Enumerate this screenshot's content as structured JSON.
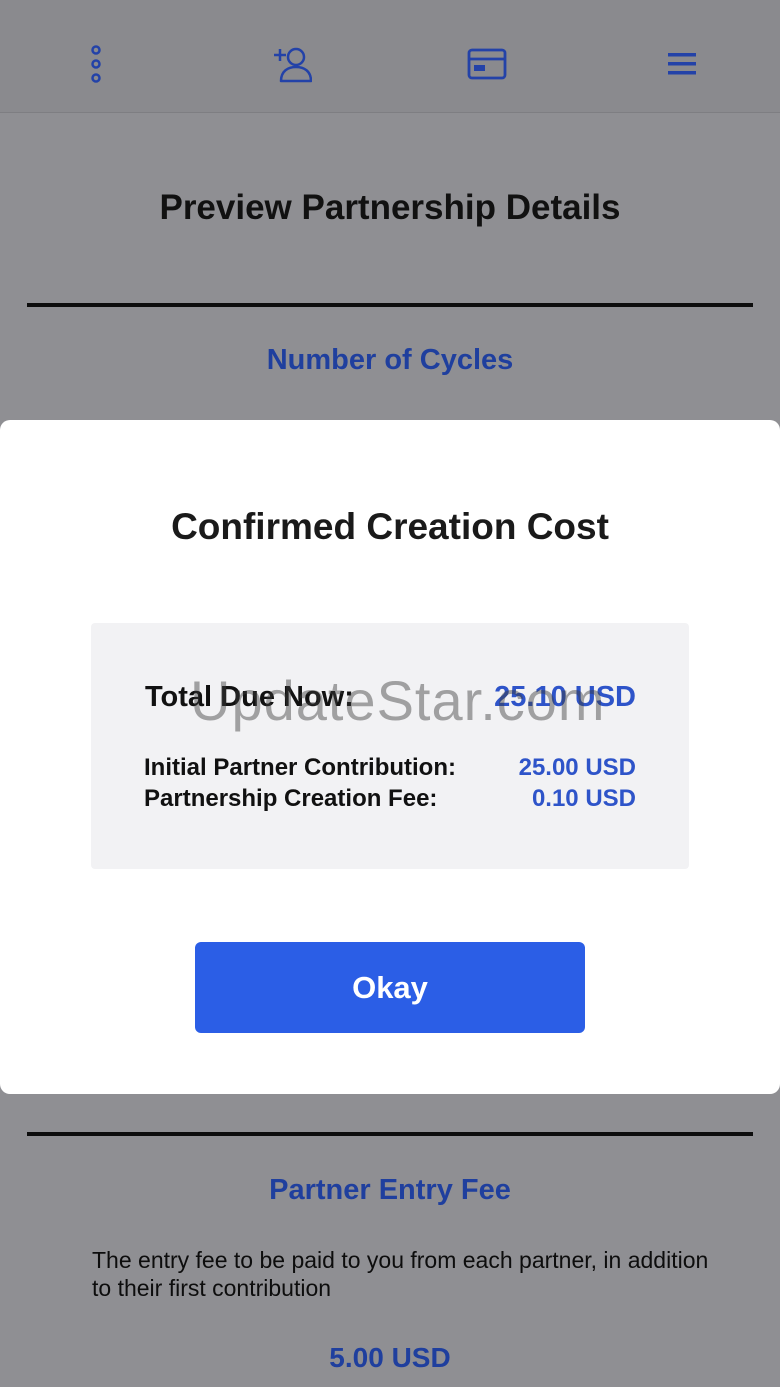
{
  "navbar": {
    "icons": [
      "more-vertical-icon",
      "add-person-icon",
      "credit-card-icon",
      "menu-icon"
    ],
    "icon_color": "#2342a8"
  },
  "page": {
    "title": "Preview Partnership Details",
    "sections": [
      {
        "heading": "Number of Cycles"
      },
      {
        "heading": "Partner Entry Fee",
        "description": "The entry fee to be paid to you from each partner, in addition to their first contribution",
        "value": "5.00 USD"
      }
    ]
  },
  "modal": {
    "title": "Confirmed Creation Cost",
    "total_label": "Total Due Now:",
    "total_value": "25.10 USD",
    "rows": [
      {
        "label": "Initial Partner Contribution:",
        "value": "25.00 USD"
      },
      {
        "label": "Partnership Creation Fee:",
        "value": "0.10 USD"
      }
    ],
    "okay_label": "Okay"
  },
  "watermark": "UpdateStar.com",
  "colors": {
    "accent": "#2b5ee6",
    "value_blue": "#2e54c9",
    "heading_blue": "#1f3f9e",
    "overlay": "#8f8f93"
  }
}
